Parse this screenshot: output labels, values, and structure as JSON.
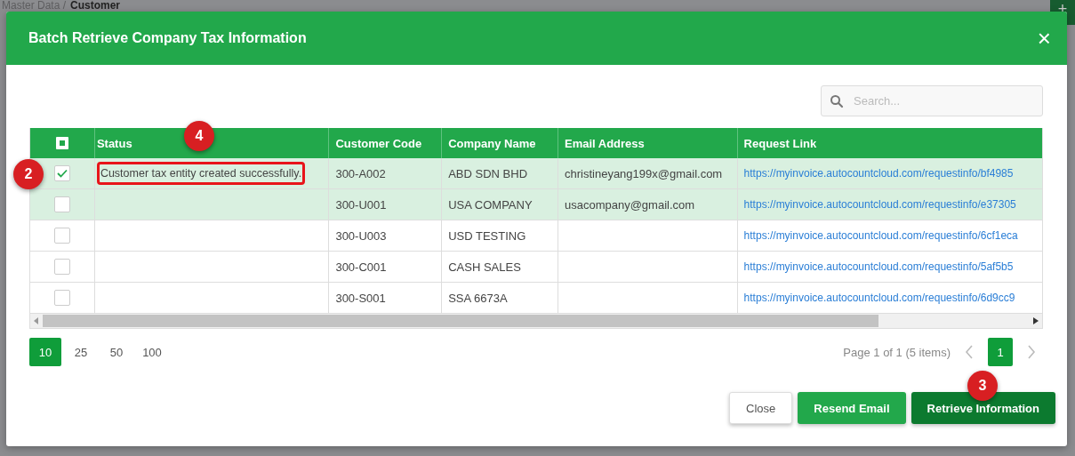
{
  "background": {
    "breadcrumb_parent": "Master Data /",
    "breadcrumb_current": "Customer",
    "add_label": "+"
  },
  "dialog": {
    "title": "Batch Retrieve Company Tax Information",
    "close_label": "×"
  },
  "search": {
    "placeholder": "Search..."
  },
  "table": {
    "header_checkbox": {
      "indeterminate": true
    },
    "columns": [
      "Status",
      "Customer Code",
      "Company Name",
      "Email Address",
      "Request Link"
    ],
    "rows": [
      {
        "selected": true,
        "checked": true,
        "status": "Customer tax entity created successfully.",
        "code": "300-A002",
        "company": "ABD SDN BHD",
        "email": "christineyang199x@gmail.com",
        "link": "https://myinvoice.autocountcloud.com/requestinfo/bf4985",
        "highlighted": true
      },
      {
        "selected": true,
        "checked": false,
        "status": "",
        "code": "300-U001",
        "company": "USA COMPANY",
        "email": "usacompany@gmail.com",
        "link": "https://myinvoice.autocountcloud.com/requestinfo/e37305",
        "highlighted": false
      },
      {
        "selected": false,
        "checked": false,
        "status": "",
        "code": "300-U003",
        "company": "USD TESTING",
        "email": "",
        "link": "https://myinvoice.autocountcloud.com/requestinfo/6cf1eca",
        "highlighted": false
      },
      {
        "selected": false,
        "checked": false,
        "status": "",
        "code": "300-C001",
        "company": "CASH SALES",
        "email": "",
        "link": "https://myinvoice.autocountcloud.com/requestinfo/5af5b5",
        "highlighted": false
      },
      {
        "selected": false,
        "checked": false,
        "status": "",
        "code": "300-S001",
        "company": "SSA 6673A",
        "email": "",
        "link": "https://myinvoice.autocountcloud.com/requestinfo/6d9cc9",
        "highlighted": false
      }
    ]
  },
  "page_sizes": [
    {
      "label": "10",
      "selected": true
    },
    {
      "label": "25",
      "selected": false
    },
    {
      "label": "50",
      "selected": false
    },
    {
      "label": "100",
      "selected": false
    }
  ],
  "pager": {
    "info": "Page 1 of 1 (5 items)",
    "pages": [
      {
        "label": "1",
        "selected": true
      }
    ]
  },
  "buttons": [
    {
      "label": "Close",
      "kind": "plain"
    },
    {
      "label": "Resend Email",
      "kind": "secondary"
    },
    {
      "label": "Retrieve Information",
      "kind": "primary"
    }
  ],
  "callouts": [
    {
      "number": "2"
    },
    {
      "number": "4"
    },
    {
      "number": "3"
    }
  ]
}
